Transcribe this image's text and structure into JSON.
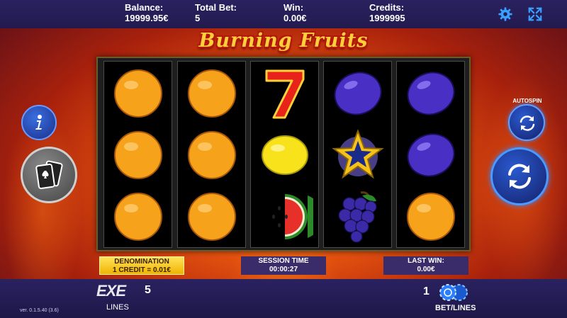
{
  "header": {
    "balance_label": "Balance:",
    "balance_value": "19999.95€",
    "total_bet_label": "Total Bet:",
    "total_bet_value": "5",
    "win_label": "Win:",
    "win_value": "0.00€",
    "credits_label": "Credits:",
    "credits_value": "1999995",
    "settings_icon": "gear-icon",
    "fullscreen_icon": "fullscreen-icon"
  },
  "game": {
    "title": "Burning Fruits",
    "reels": [
      [
        "orange",
        "orange",
        "orange"
      ],
      [
        "orange",
        "orange",
        "orange"
      ],
      [
        "seven",
        "lemon",
        "watermelon"
      ],
      [
        "plum",
        "star",
        "grapes"
      ],
      [
        "plum",
        "plum",
        "orange"
      ]
    ]
  },
  "buttons": {
    "info_icon": "info-icon",
    "gamble_icon": "cards-icon",
    "autospin_label": "AUTOSPIN",
    "autospin_icon": "autospin-icon",
    "spin_icon": "spin-icon"
  },
  "panels": {
    "denomination_label": "DENOMINATION",
    "denomination_value": "1 CREDIT = 0.01€",
    "session_time_label": "SESSION TIME",
    "session_time_value": "00:00:27",
    "last_win_label": "LAST WIN:",
    "last_win_value": "0.00€"
  },
  "footer": {
    "lines_logo": "EXE",
    "lines_value": "5",
    "lines_label": "LINES",
    "bet_value": "1",
    "bet_lines_label": "BET/LINES",
    "version": "ver. 0.1.5.40 (3.6)"
  },
  "colors": {
    "bar_bg": "#2a2260",
    "accent_blue": "#2a7fff",
    "gold_panel": "#ffd23a"
  }
}
